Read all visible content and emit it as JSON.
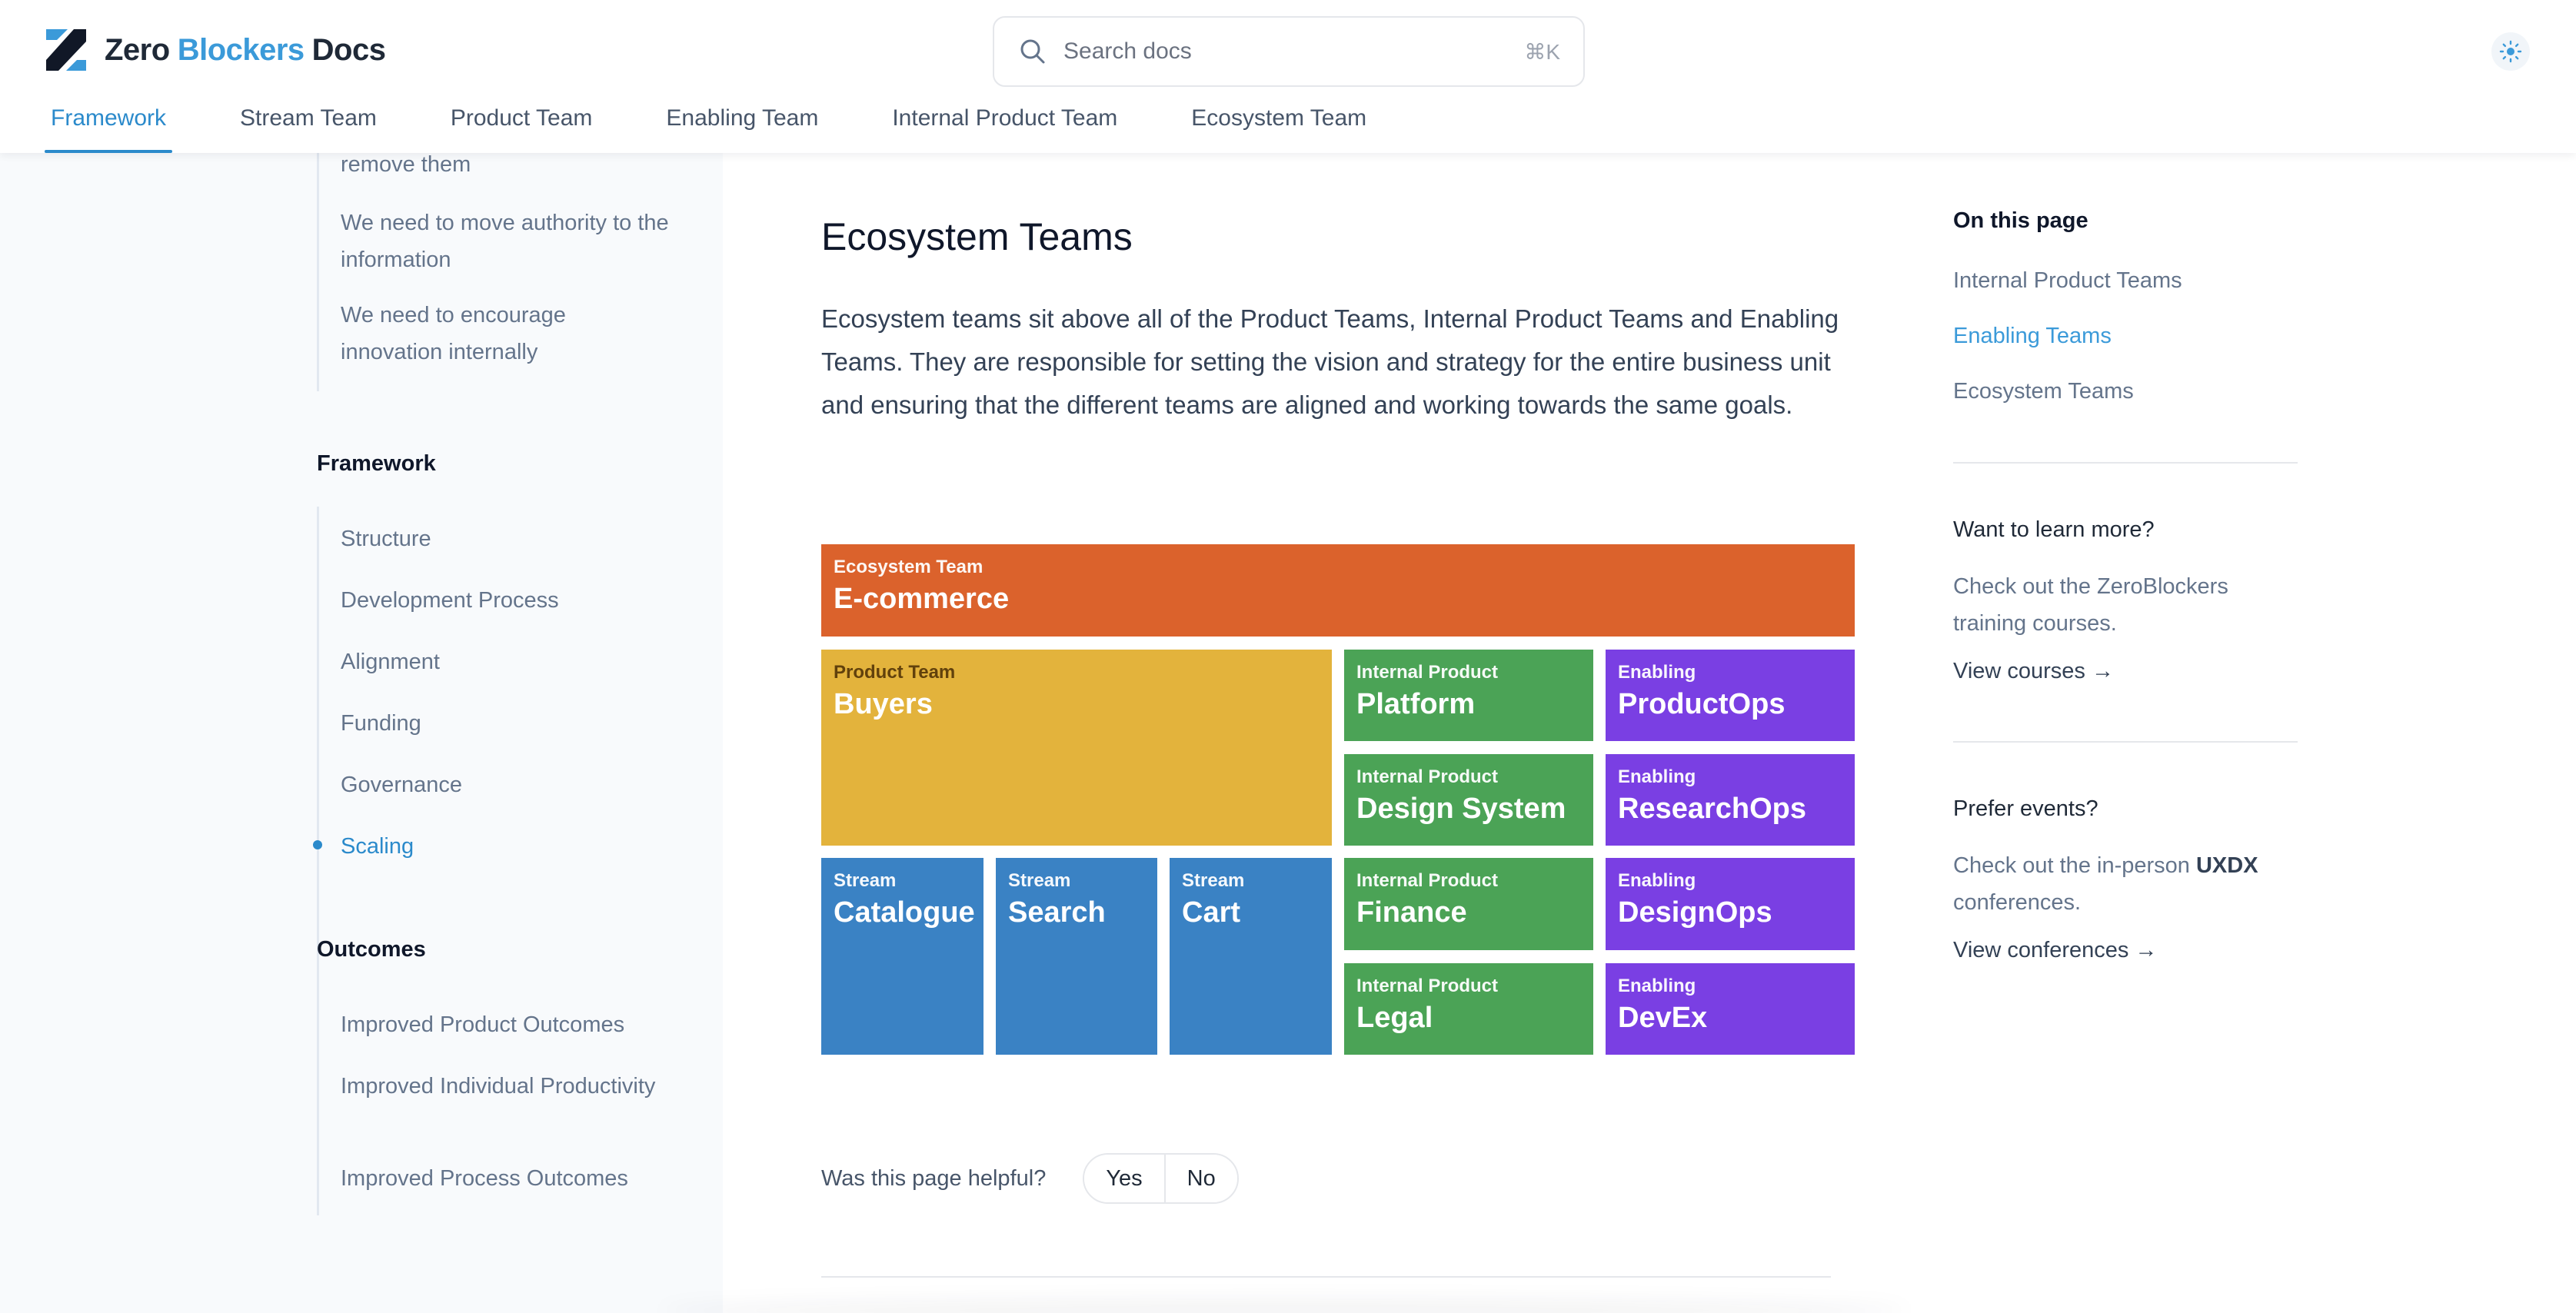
{
  "brand": {
    "zero": "Zero",
    "blockers": "Blockers",
    "docs": "Docs",
    "accent": "#3b9ad9"
  },
  "search": {
    "placeholder": "Search docs",
    "shortcut": "⌘K"
  },
  "theme_toggle": {
    "icon": "sun-icon"
  },
  "tabs": [
    {
      "label": "Framework",
      "active": true
    },
    {
      "label": "Stream Team"
    },
    {
      "label": "Product Team"
    },
    {
      "label": "Enabling Team"
    },
    {
      "label": "Internal Product Team"
    },
    {
      "label": "Ecosystem Team"
    }
  ],
  "sidebar": {
    "prev_items": [
      "remove them",
      "We need to move authority to the information",
      "We need to encourage innovation internally"
    ],
    "framework": {
      "title": "Framework",
      "items": [
        "Structure",
        "Development Process",
        "Alignment",
        "Funding",
        "Governance",
        "Scaling"
      ],
      "active": "Scaling"
    },
    "outcomes": {
      "title": "Outcomes",
      "items": [
        "Improved Product Outcomes",
        "Improved Individual Productivity",
        "Improved Process Outcomes"
      ]
    }
  },
  "main": {
    "title": "Ecosystem Teams",
    "lead": "Ecosystem teams sit above all of the Product Teams, Internal Product Teams and Enabling Teams. They are responsible for setting the vision and strategy for the entire business unit and ensuring that the different teams are aligned and working towards the same goals.",
    "diagram": {
      "ecosystem": {
        "kind": "Ecosystem Team",
        "name": "E-commerce",
        "color": "#db622c"
      },
      "product": {
        "kind": "Product Team",
        "name": "Buyers",
        "color": "#e3b33c"
      },
      "streams": [
        {
          "kind": "Stream",
          "name": "Catalogue"
        },
        {
          "kind": "Stream",
          "name": "Search"
        },
        {
          "kind": "Stream",
          "name": "Cart"
        }
      ],
      "internal": [
        {
          "kind": "Internal Product",
          "name": "Platform"
        },
        {
          "kind": "Internal Product",
          "name": "Design System"
        },
        {
          "kind": "Internal Product",
          "name": "Finance"
        },
        {
          "kind": "Internal Product",
          "name": "Legal"
        }
      ],
      "enabling": [
        {
          "kind": "Enabling",
          "name": "ProductOps"
        },
        {
          "kind": "Enabling",
          "name": "ResearchOps"
        },
        {
          "kind": "Enabling",
          "name": "DesignOps"
        },
        {
          "kind": "Enabling",
          "name": "DevEx"
        }
      ],
      "colors": {
        "stream": "#3a82c4",
        "internal": "#4ba356",
        "enabling": "#7a3fe3"
      }
    },
    "helpful": {
      "question": "Was this page helpful?",
      "yes": "Yes",
      "no": "No"
    }
  },
  "rail": {
    "on_this_page": "On this page",
    "toc": [
      {
        "label": "Internal Product Teams"
      },
      {
        "label": "Enabling Teams",
        "active": true
      },
      {
        "label": "Ecosystem Teams"
      }
    ],
    "learn": {
      "title": "Want to learn more?",
      "text": "Check out the ZeroBlockers training courses.",
      "link": "View courses →"
    },
    "events": {
      "title": "Prefer events?",
      "text_pre": "Check out the in-person ",
      "text_bold": "UXDX",
      "text_post": " conferences.",
      "link": "View conferences →"
    }
  }
}
